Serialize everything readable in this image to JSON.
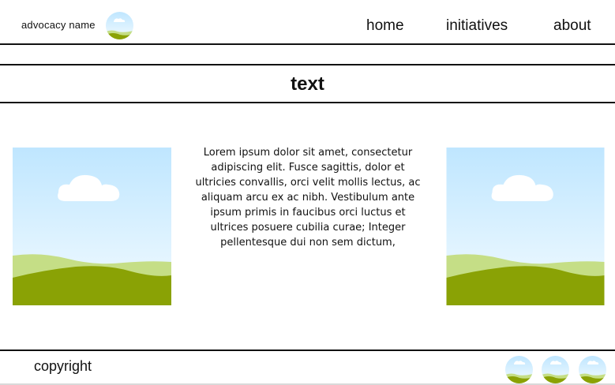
{
  "header": {
    "brand": "advocacy name",
    "logo_icon": "landscape-circle-icon",
    "nav": [
      {
        "label": "home"
      },
      {
        "label": "initiatives"
      },
      {
        "label": "about"
      }
    ]
  },
  "banner": {
    "title": "text"
  },
  "main": {
    "images": [
      {
        "icon": "landscape-image"
      },
      {
        "icon": "landscape-image"
      }
    ],
    "paragraph": "Lorem ipsum dolor sit amet, consectetur adipiscing elit. Fusce sagittis, dolor et ultricies convallis, orci velit mollis lectus, ac aliquam arcu ex ac nibh. Vestibulum ante ipsum primis in faucibus orci luctus et ultrices posuere cubilia curae; Integer pellentesque dui non sem dictum,"
  },
  "footer": {
    "copyright": "copyright",
    "social_icons": [
      "landscape-circle-icon",
      "landscape-circle-icon",
      "landscape-circle-icon"
    ]
  },
  "colors": {
    "sky_top": "#bfe6ff",
    "sky_bottom": "#f3fbff",
    "hill_light": "#c5de86",
    "hill_dark": "#8aa205",
    "cloud": "#ffffff",
    "rule": "#111111"
  }
}
